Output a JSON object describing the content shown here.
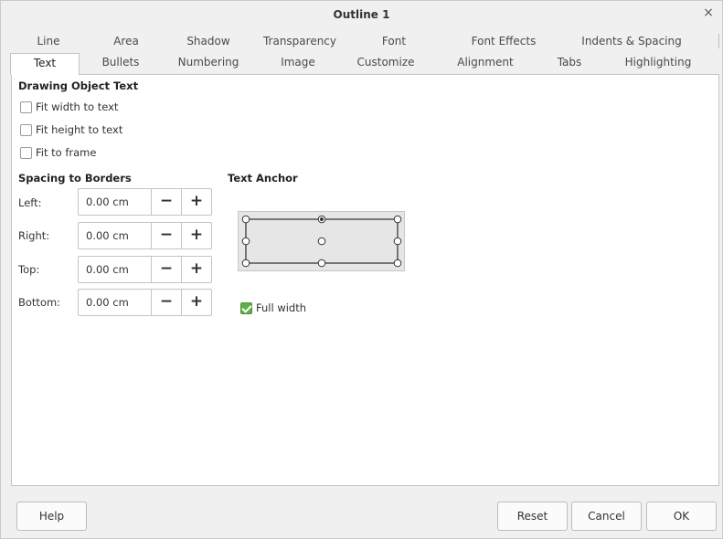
{
  "window": {
    "title": "Outline 1",
    "close_glyph": "×",
    "close_icon": "close-icon"
  },
  "tabs_row1": [
    "Line",
    "Area",
    "Shadow",
    "Transparency",
    "Font",
    "Font Effects",
    "Indents & Spacing"
  ],
  "tabs_row2": [
    "Text",
    "Bullets",
    "Numbering",
    "Image",
    "Customize",
    "Alignment",
    "Tabs",
    "Highlighting"
  ],
  "active_tab": "Text",
  "drawing_object_text": {
    "title": "Drawing Object Text",
    "options": [
      {
        "label": "Fit width to text",
        "checked": false
      },
      {
        "label": "Fit height to text",
        "checked": false
      },
      {
        "label": "Fit to frame",
        "checked": false
      }
    ]
  },
  "spacing": {
    "title": "Spacing to Borders",
    "fields": [
      {
        "label": "Left:",
        "value": "0.00 cm"
      },
      {
        "label": "Right:",
        "value": "0.00 cm"
      },
      {
        "label": "Top:",
        "value": "0.00 cm"
      },
      {
        "label": "Bottom:",
        "value": "0.00 cm"
      }
    ],
    "minus_glyph": "−",
    "plus_glyph": "+"
  },
  "text_anchor": {
    "title": "Text Anchor",
    "selected": "top-center",
    "full_width": {
      "label": "Full width",
      "checked": true
    }
  },
  "buttons": {
    "help": "Help",
    "reset": "Reset",
    "cancel": "Cancel",
    "ok": "OK"
  },
  "colors": {
    "accent_check": "#5fae48",
    "panel_bg": "#ffffff",
    "dialog_bg": "#f0f0f0"
  }
}
